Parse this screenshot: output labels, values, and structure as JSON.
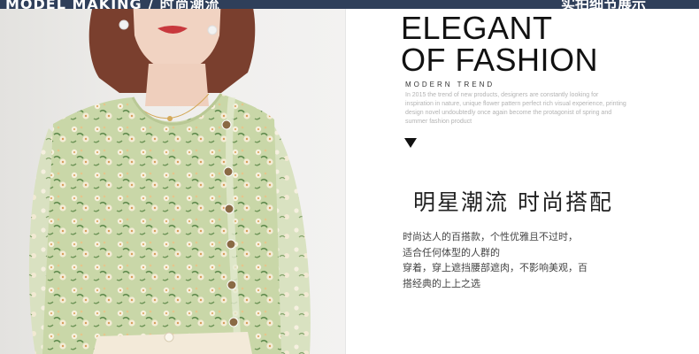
{
  "banner": {
    "left_text": "MODEL MAKING / 时尚潮流",
    "right_text": "实拍细节展示"
  },
  "heading": {
    "line1": "ELEGANT",
    "line2": "OF FASHION",
    "sub": "MODERN TREND",
    "description": "In 2015 the trend of new products, designers are constantly looking for inspiration in nature, unique flower pattern perfect rich visual experience, printing design novel undoubtedly once again become the protagonist of spring and summer fashion product"
  },
  "chinese": {
    "heading": "明星潮流 时尚搭配",
    "lines": [
      "时尚达人的百搭款，个性优雅且不过时，",
      "适合任何体型的人群的",
      "穿着，穿上遮挡腰部遮肉，不影响美观，百",
      "搭经典的上上之选"
    ]
  },
  "colors": {
    "banner_bg": "#2f3f5a",
    "blouse": "#c9d7a8",
    "hair": "#7a3f2e"
  },
  "icons": {
    "marker": "down-triangle-icon"
  }
}
